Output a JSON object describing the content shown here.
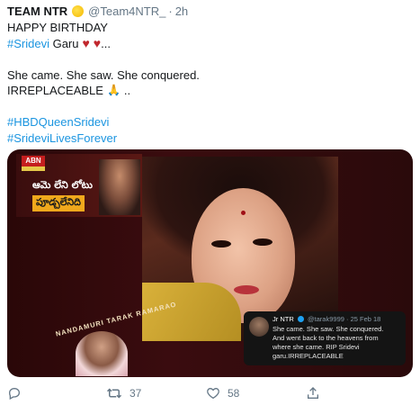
{
  "tweet": {
    "display_name": "TEAM NTR",
    "handle": "@Team4NTR_",
    "separator": "·",
    "time": "2h",
    "lines": {
      "l1": "HAPPY BIRTHDAY",
      "l2_tag": "#Sridevi",
      "l2_rest": " Garu",
      "l2_end": "...",
      "l3": "She came. She saw. She conquered.",
      "l4": "IRREPLACEABLE",
      "l4_end": "..",
      "tag1": "#HBDQueenSridevi",
      "tag2": "#SrideviLivesForever"
    }
  },
  "media": {
    "abn_logo": "ABN",
    "telugu_line1": "ఆమె లేని లోటు",
    "telugu_line2": "పూడ్చలేనిది",
    "badge_text": "NANDAMURI TARAK RAMARAO",
    "embedded": {
      "name": "Jr NTR",
      "meta": "@tarak9999 · 25 Feb 18",
      "line1": "She came. She saw. She conquered.",
      "line2": "And went back to the heavens from",
      "line3": "where she came. RIP Sridevi",
      "line4": "garu.IRREPLACEABLE"
    }
  },
  "actions": {
    "reply_count": "",
    "retweet_count": "37",
    "like_count": "58"
  },
  "colors": {
    "hashtag": "#1b95e0",
    "heart": "#c1272d",
    "meta_gray": "#657786"
  },
  "icons": [
    "sun-emoji-icon",
    "heart-icon",
    "pray-icon",
    "reply-icon",
    "retweet-icon",
    "like-icon",
    "share-icon"
  ]
}
